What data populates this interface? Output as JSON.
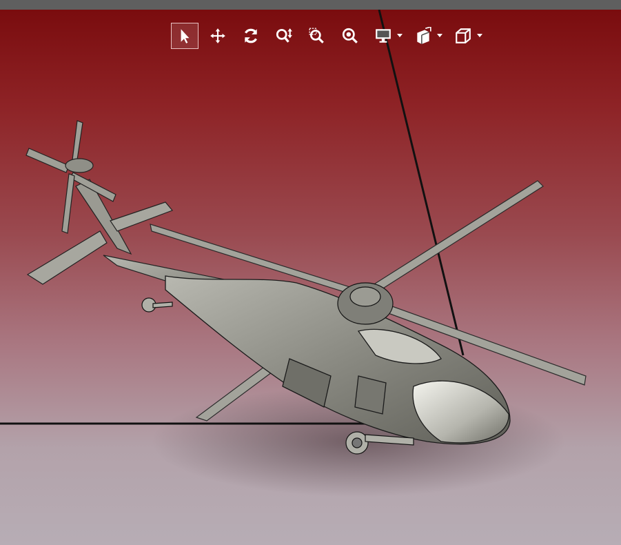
{
  "app": {
    "toolbar": {
      "tools": [
        {
          "id": "select",
          "icon": "cursor-arrow-icon",
          "active": true
        },
        {
          "id": "pan",
          "icon": "move-arrows-icon",
          "active": false
        },
        {
          "id": "rotate",
          "icon": "rotate-icon",
          "active": false
        },
        {
          "id": "zoom-vertical",
          "icon": "zoom-vertical-icon",
          "active": false
        },
        {
          "id": "zoom-area",
          "icon": "zoom-area-icon",
          "active": false
        },
        {
          "id": "zoom-fit",
          "icon": "zoom-fit-icon",
          "active": false
        },
        {
          "id": "display-mode",
          "icon": "monitor-icon",
          "active": false,
          "has_dropdown": true
        },
        {
          "id": "section-view",
          "icon": "section-view-icon",
          "active": false,
          "has_dropdown": true
        },
        {
          "id": "view-orientation",
          "icon": "cube-icon",
          "active": false,
          "has_dropdown": true
        }
      ]
    },
    "colors": {
      "background_top": "#7a0c0e",
      "background_bottom": "#b7adb5",
      "model": "#8f8f87",
      "model_highlight": "#e8e8e2",
      "edges": "#1a1a1a"
    }
  }
}
